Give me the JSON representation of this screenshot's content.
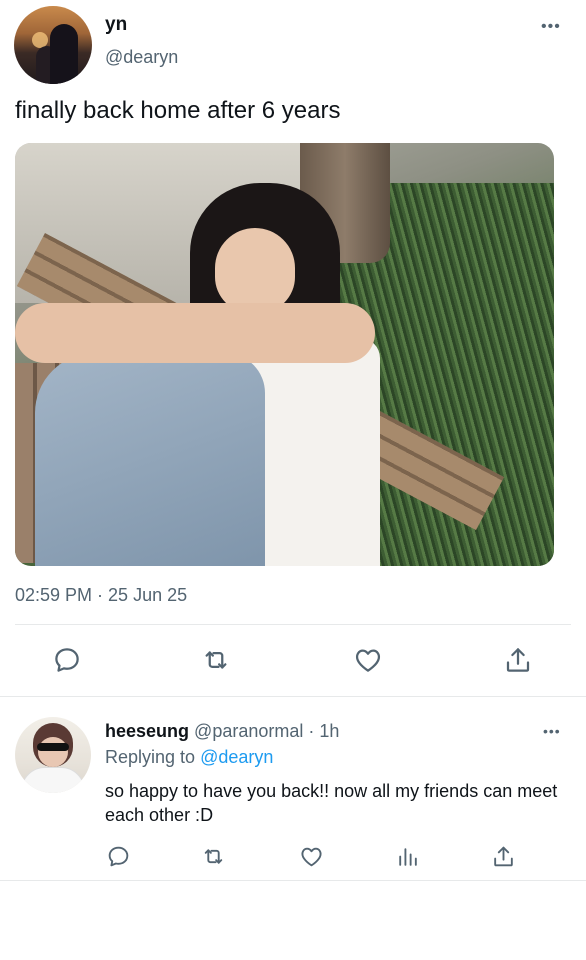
{
  "tweet": {
    "display_name": "yn",
    "handle": "@dearyn",
    "more": "•••",
    "text": "finally back home after 6 years",
    "timestamp": "02:59 PM · 25 Jun 25",
    "actions": [
      "comment-icon",
      "retweet-icon",
      "heart-icon",
      "share-icon"
    ]
  },
  "reply": {
    "display_name": "heeseung",
    "handle": "@paranormal",
    "separator": "·",
    "time": "1h",
    "more": "•••",
    "replying_prefix": "Replying to",
    "replying_to": "@dearyn",
    "text": "so happy to have you back!! now all my friends can meet each other :D",
    "actions": [
      "comment-icon",
      "retweet-icon",
      "heart-icon",
      "analytics-icon",
      "share-icon"
    ]
  },
  "colors": {
    "text": "#0f1419",
    "secondary": "#536471",
    "link": "#1d9bf0",
    "divider": "#e7e9ea"
  }
}
